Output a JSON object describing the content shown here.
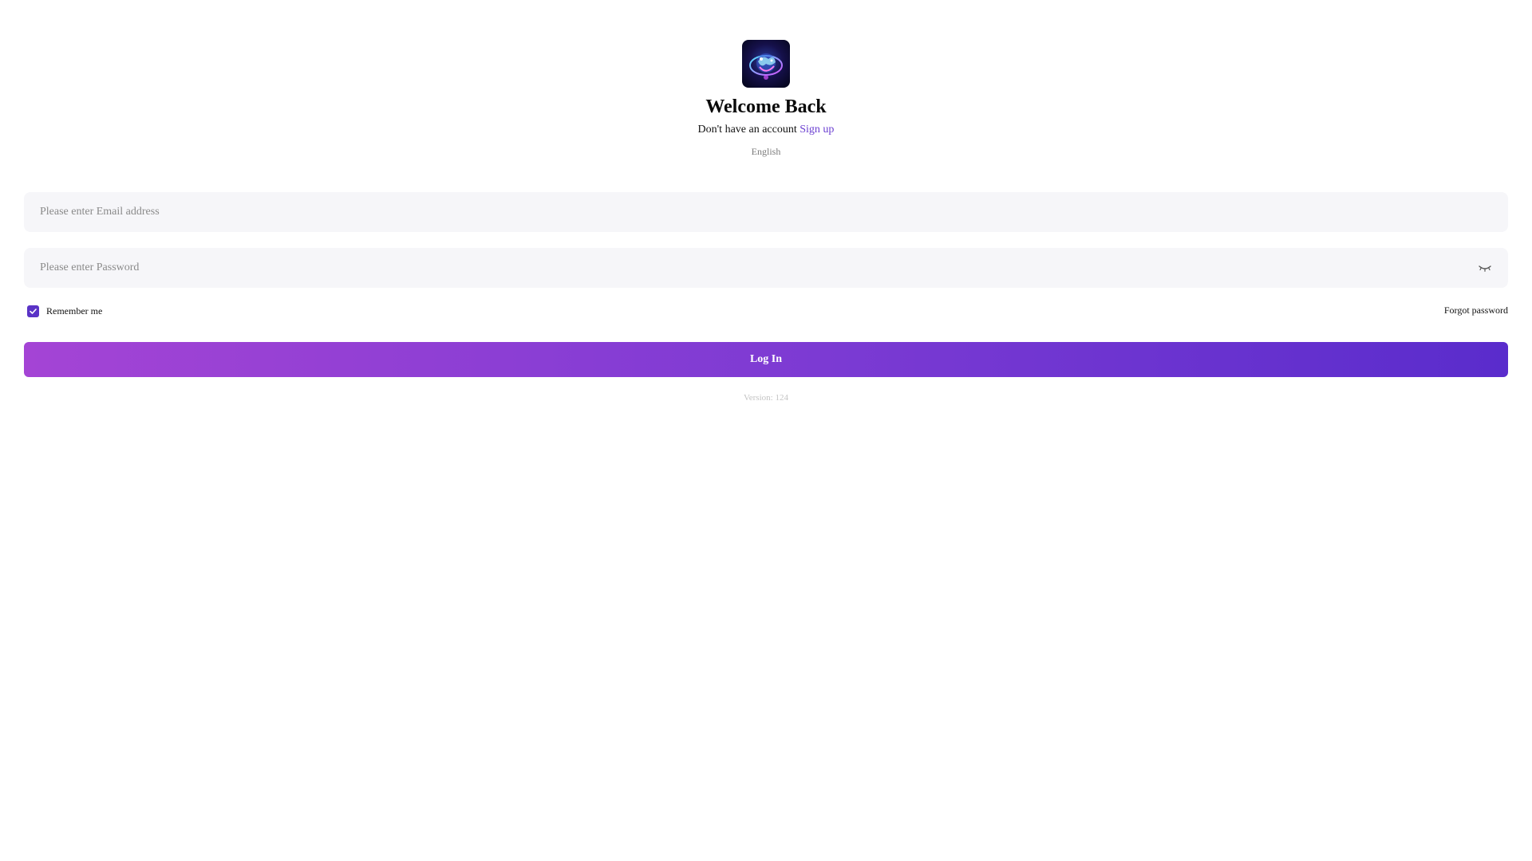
{
  "header": {
    "logo_icon": "brain-globe-logo",
    "title": "Welcome Back",
    "signup_prompt": "Don't have an account",
    "signup_link": "Sign up",
    "language": "English"
  },
  "form": {
    "email_placeholder": "Please enter Email address",
    "email_value": "",
    "password_placeholder": "Please enter Password",
    "password_value": "",
    "password_toggle_icon": "eye-closed-icon",
    "remember_label": "Remember me",
    "remember_checked": true,
    "forgot_password": "Forgot password",
    "login_label": "Log In"
  },
  "footer": {
    "version": "Version: 124"
  },
  "colors": {
    "accent": "#6b3fd1",
    "checkbox": "#5a33c6",
    "button_gradient_start": "#a444d5",
    "button_gradient_end": "#5a2ccc",
    "input_background": "#f6f6f9"
  }
}
